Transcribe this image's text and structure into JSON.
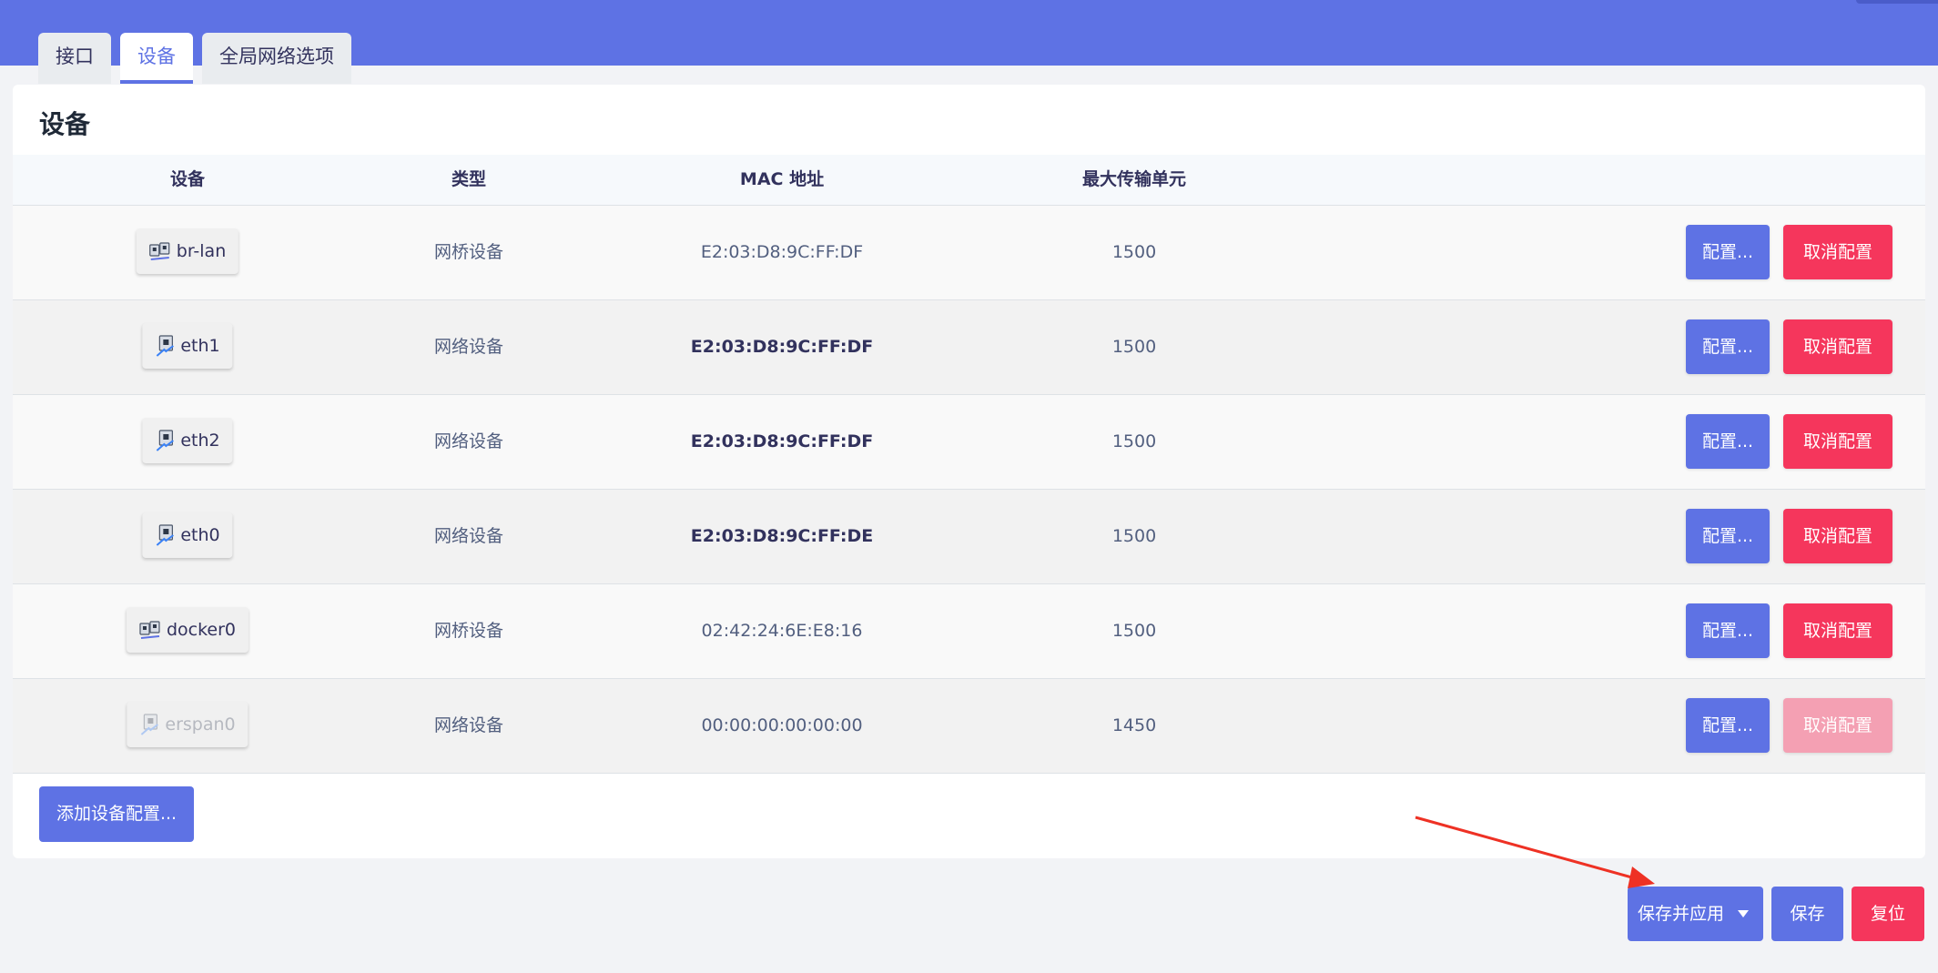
{
  "tabs": [
    {
      "label": "接口",
      "active": false
    },
    {
      "label": "设备",
      "active": true
    },
    {
      "label": "全局网络选项",
      "active": false
    }
  ],
  "panel": {
    "title": "设备",
    "columns": {
      "device": "设备",
      "type": "类型",
      "mac": "MAC 地址",
      "mtu": "最大传输单元"
    },
    "rows": [
      {
        "device": "br-lan",
        "icon": "bridge-icon",
        "type": "网桥设备",
        "mac": "E2:03:D8:9C:FF:DF",
        "mtu": "1500",
        "configure": "配置...",
        "unconfigure": "取消配置",
        "disabled": false
      },
      {
        "device": "eth1",
        "icon": "ethernet-port-icon",
        "type": "网络设备",
        "mac": "E2:03:D8:9C:FF:DF",
        "mtu": "1500",
        "configure": "配置...",
        "unconfigure": "取消配置",
        "disabled": false
      },
      {
        "device": "eth2",
        "icon": "ethernet-port-icon",
        "type": "网络设备",
        "mac": "E2:03:D8:9C:FF:DF",
        "mtu": "1500",
        "configure": "配置...",
        "unconfigure": "取消配置",
        "disabled": false
      },
      {
        "device": "eth0",
        "icon": "ethernet-port-icon",
        "type": "网络设备",
        "mac": "E2:03:D8:9C:FF:DE",
        "mtu": "1500",
        "configure": "配置...",
        "unconfigure": "取消配置",
        "disabled": false
      },
      {
        "device": "docker0",
        "icon": "bridge-icon",
        "type": "网桥设备",
        "mac": "02:42:24:6E:E8:16",
        "mtu": "1500",
        "configure": "配置...",
        "unconfigure": "取消配置",
        "disabled": false
      },
      {
        "device": "erspan0",
        "icon": "ethernet-port-icon",
        "type": "网络设备",
        "mac": "00:00:00:00:00:00",
        "mtu": "1450",
        "configure": "配置...",
        "unconfigure": "取消配置",
        "disabled": true
      }
    ],
    "add_button": "添加设备配置..."
  },
  "footer": {
    "save_apply": "保存并应用",
    "save": "保存",
    "reset": "复位"
  },
  "colors": {
    "header": "#5e72e4",
    "primary": "#5e72e4",
    "danger": "#f5365c",
    "annotation_arrow": "#ee3124"
  }
}
